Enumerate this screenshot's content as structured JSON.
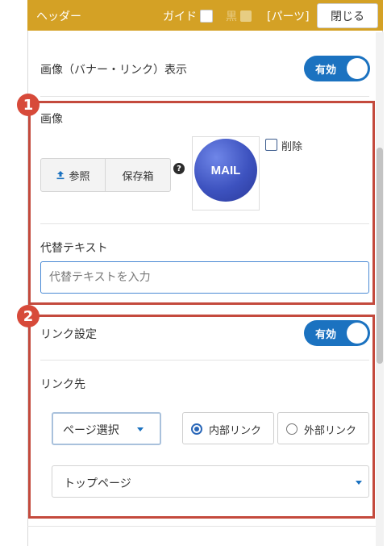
{
  "header": {
    "title": "ヘッダー",
    "guide_label": "ガイド",
    "black_label": "黒",
    "parts_label": "[パーツ]",
    "close_label": "閉じる"
  },
  "image_link_display": {
    "label": "画像（バナー・リンク）表示",
    "toggle_label": "有効"
  },
  "section1": {
    "badge": "1",
    "image_label": "画像",
    "browse_label": "参照",
    "storage_label": "保存箱",
    "help_icon": "?",
    "thumbnail_text": "MAIL",
    "delete_label": "削除",
    "alt_text_label": "代替テキスト",
    "alt_text_value": "",
    "alt_text_placeholder": "代替テキストを入力"
  },
  "section2": {
    "badge": "2",
    "link_setting_label": "リンク設定",
    "toggle_label": "有効",
    "link_target_label": "リンク先",
    "page_select_label": "ページ選択",
    "radio_internal": "内部リンク",
    "radio_external": "外部リンク",
    "selected_radio": "internal",
    "page_value": "トップページ"
  },
  "colors": {
    "header_bg": "#d4a125",
    "accent": "#1b72c0",
    "highlight_border": "#c44a3d",
    "badge": "#d74a3a"
  }
}
